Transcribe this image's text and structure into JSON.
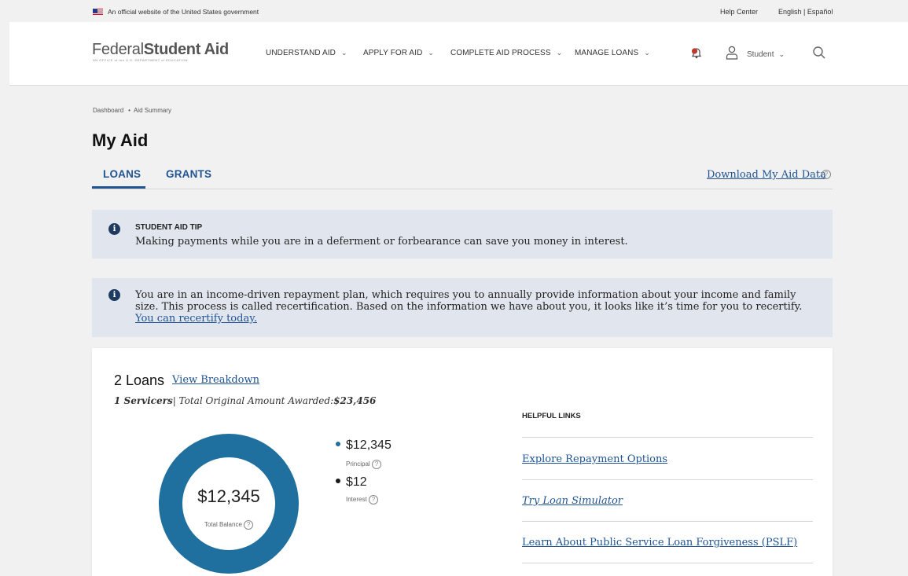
{
  "gov_banner": {
    "text": "An official website of the United States government",
    "help_center": "Help Center",
    "language": "English | Español"
  },
  "header": {
    "logo_federal": "Federal",
    "logo_student_aid": "Student Aid",
    "logo_subtitle": "AN OFFICE of the U.S. DEPARTMENT of EDUCATION",
    "nav": [
      {
        "label": "UNDERSTAND AID"
      },
      {
        "label": "APPLY FOR AID"
      },
      {
        "label": "COMPLETE AID PROCESS"
      },
      {
        "label": "MANAGE LOANS"
      }
    ],
    "user_label": "Student",
    "colors": {
      "accent": "#205493",
      "bell_badge": "#c0392b"
    }
  },
  "breadcrumb": {
    "dashboard": "Dashboard",
    "current": "Aid Summary"
  },
  "page_title": "My Aid",
  "tabs": [
    {
      "label": "LOANS",
      "active": true
    },
    {
      "label": "GRANTS",
      "active": false
    }
  ],
  "download_link": "Download My Aid Data",
  "alerts": {
    "tip_title": "STUDENT AID TIP",
    "tip_message": "Making payments while you are in a deferment or forbearance can save you money in interest.",
    "idr_message": "You are in an income-driven repayment plan, which requires you to annually provide information about your income and family size. This process is called recertification. Based on the information we have about you, it looks like it’s time for you to recertify.",
    "idr_link": "You can recertify today."
  },
  "loans_card": {
    "count_label": "2 Loans",
    "view_breakdown": "View Breakdown",
    "servicers_count": "1 Servicers",
    "summary_rest": "| Total Original Amount Awarded:",
    "total_awarded": "$23,456",
    "total_balance": "$12,345",
    "total_balance_label": "Total Balance",
    "legend": [
      {
        "value": "$12,345",
        "label": "Principal",
        "color": "#1f6f9f"
      },
      {
        "value": "$12",
        "label": "Interest",
        "color": "#1a1a1a"
      }
    ],
    "donut_color": "#1f6f9f"
  },
  "helpful_links": {
    "title": "HELPFUL LINKS",
    "links": [
      {
        "label": "Explore Repayment Options",
        "italic": false
      },
      {
        "label": "Try Loan Simulator",
        "italic": true
      },
      {
        "label": "Learn About Public Service Loan Forgiveness (PSLF)",
        "italic": false
      }
    ]
  }
}
